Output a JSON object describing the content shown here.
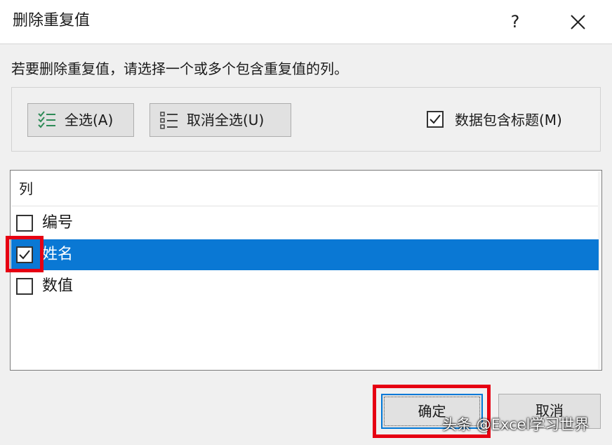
{
  "dialog": {
    "title": "删除重复值",
    "help_label": "?"
  },
  "instruction": "若要删除重复值，请选择一个或多个包含重复值的列。",
  "toolbar": {
    "select_all_label": "全选(A)",
    "unselect_all_label": "取消全选(U)",
    "headers_label": "数据包含标题(M)",
    "headers_checked": true
  },
  "columns_list": {
    "header": "列",
    "items": [
      {
        "label": "编号",
        "checked": false,
        "selected": false
      },
      {
        "label": "姓名",
        "checked": true,
        "selected": true
      },
      {
        "label": "数值",
        "checked": false,
        "selected": false
      }
    ]
  },
  "footer": {
    "ok_label": "确定",
    "cancel_label": "取消"
  },
  "watermark": "头条 @Excel学习世界",
  "colors": {
    "selection": "#0a78d4",
    "highlight": "#e60012",
    "focus_border": "#0078d7"
  }
}
